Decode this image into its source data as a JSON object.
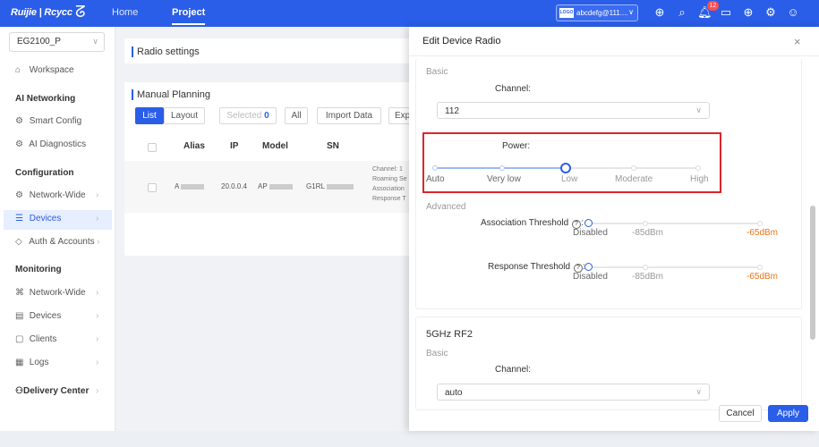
{
  "header": {
    "brand": "Ruijie | Rcycc",
    "nav": [
      "Home",
      "Project"
    ],
    "account": {
      "logo_tag": "LOGO",
      "label": "abcdefg@111....",
      "chevron": "chevron-down-icon"
    },
    "notification_count": "12",
    "icons": [
      "add-circle-icon",
      "search-icon",
      "bell-icon",
      "message-icon",
      "globe-icon",
      "settings-icon",
      "user-icon"
    ],
    "accent_color": "#2a5ee8"
  },
  "sidebar": {
    "device_select": "EG2100_P",
    "items": [
      {
        "label": "Workspace",
        "icon": "home-icon",
        "type": "item"
      },
      {
        "label": "AI Networking",
        "type": "group"
      },
      {
        "label": "Smart Config",
        "icon": "gear-icon",
        "type": "item"
      },
      {
        "label": "AI Diagnostics",
        "icon": "gear-icon",
        "type": "item"
      },
      {
        "label": "Configuration",
        "type": "group"
      },
      {
        "label": "Network-Wide",
        "icon": "gear-icon",
        "type": "item",
        "arrow": "›"
      },
      {
        "label": "Devices",
        "icon": "list-icon",
        "type": "item",
        "arrow": "›",
        "active": true
      },
      {
        "label": "Auth & Accounts",
        "icon": "shield-icon",
        "type": "item",
        "arrow": "›"
      },
      {
        "label": "Monitoring",
        "type": "group"
      },
      {
        "label": "Network-Wide",
        "icon": "network-icon",
        "type": "item",
        "arrow": "›"
      },
      {
        "label": "Devices",
        "icon": "devices-icon",
        "type": "item",
        "arrow": "›"
      },
      {
        "label": "Clients",
        "icon": "clients-icon",
        "type": "item",
        "arrow": "›"
      },
      {
        "label": "Logs",
        "icon": "logs-icon",
        "type": "item",
        "arrow": "›"
      },
      {
        "label": "Delivery Center",
        "icon": "delivery-icon",
        "type": "group-item",
        "arrow": "›"
      }
    ]
  },
  "main": {
    "radio_settings_title": "Radio settings",
    "manual_planning_title": "Manual Planning",
    "toolbar": {
      "list": "List",
      "layout": "Layout",
      "selected_label": "Selected",
      "selected_count": "0",
      "all": "All",
      "import": "Import Data",
      "export": "Exp"
    },
    "table": {
      "headers": [
        "Alias",
        "IP",
        "Model",
        "SN"
      ],
      "row": {
        "alias": "A",
        "ip": "20.0.0.4",
        "model": "AP",
        "sn": "G1RL"
      },
      "info_lines": [
        "Channel: 1",
        "Roaming Se",
        "Association",
        "Response T"
      ]
    }
  },
  "drawer": {
    "title": "Edit Device Radio",
    "close": "×",
    "basic": "Basic",
    "channel_label": "Channel:",
    "channel_value": "112",
    "power_label": "Power:",
    "power_levels": [
      "Auto",
      "Very low",
      "Low",
      "Moderate",
      "High"
    ],
    "power_selected": "Low",
    "advanced": "Advanced",
    "assoc_label": "Association Threshold",
    "resp_label": "Response Threshold",
    "threshold_ticks": [
      "Disabled",
      "-85dBm",
      "-65dBm"
    ],
    "threshold_value": "Disabled",
    "rf2_title": "5GHz RF2",
    "rf2_basic": "Basic",
    "rf2_channel_label": "Channel:",
    "rf2_channel_value": "auto",
    "cancel": "Cancel",
    "apply": "Apply",
    "highlight_color": "#d9262c"
  }
}
